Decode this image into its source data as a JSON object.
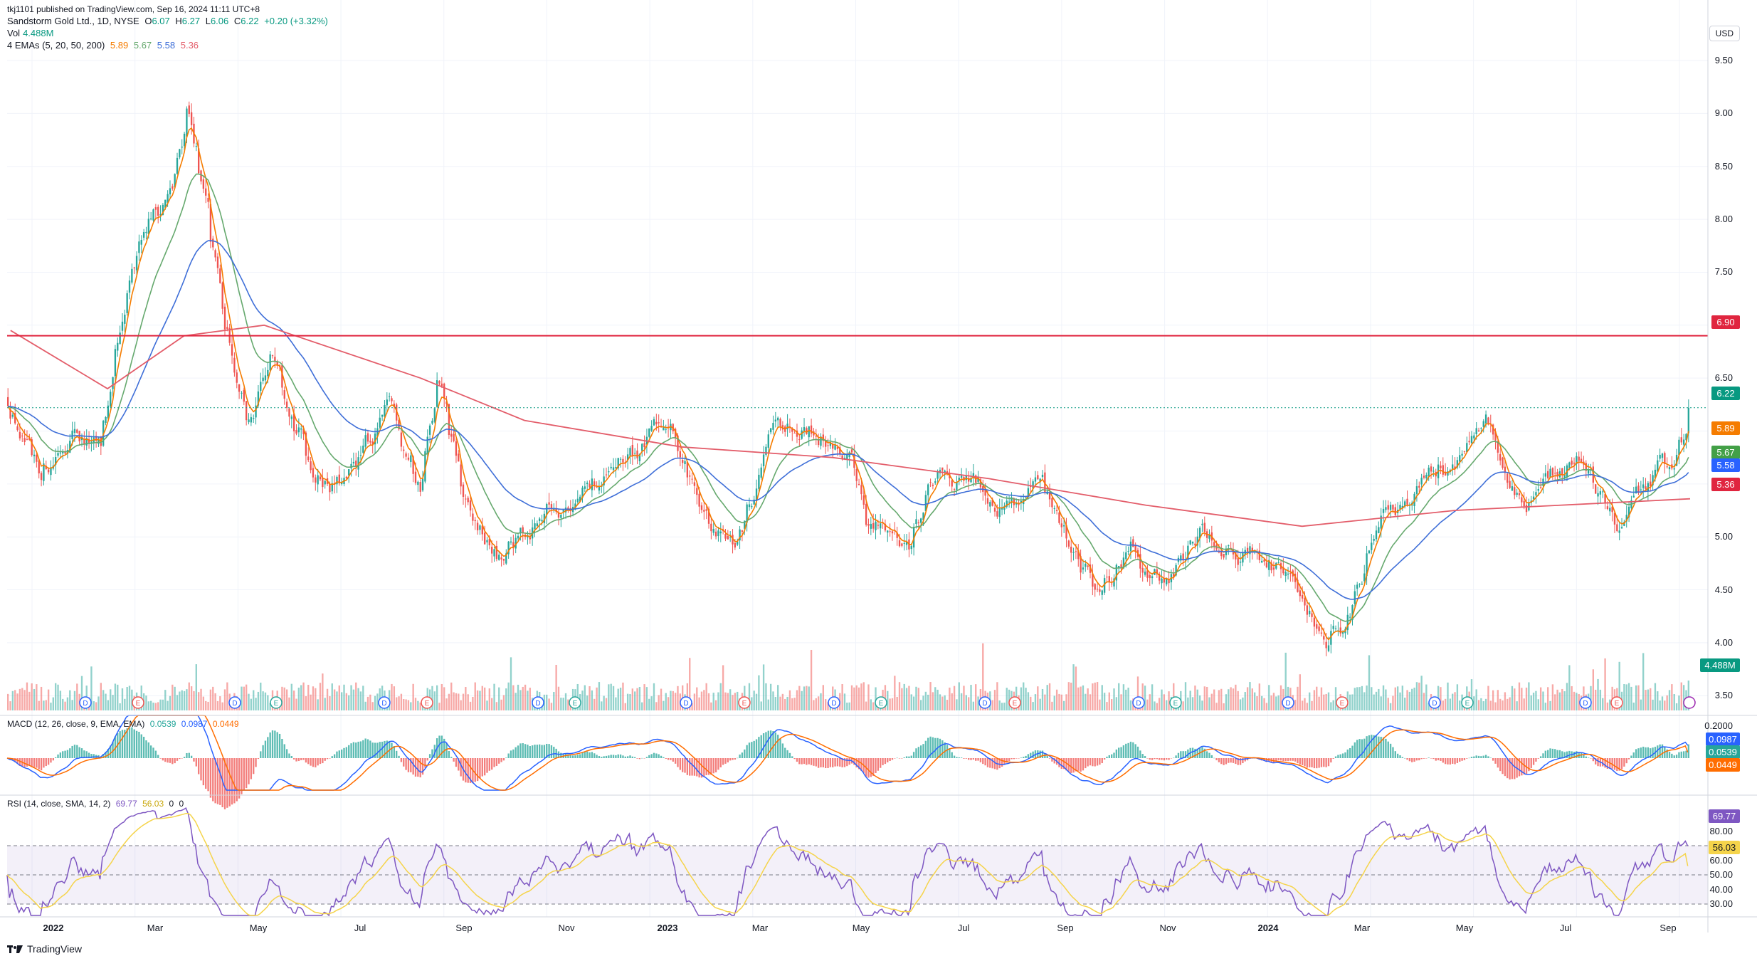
{
  "header": {
    "published": "tkj1101 published on TradingView.com, Sep 16, 2024 11:11 UTC+8",
    "symbol": "Sandstorm Gold Ltd., 1D, NYSE",
    "o_label": "O",
    "o_val": "6.07",
    "h_label": "H",
    "h_val": "6.27",
    "l_label": "L",
    "l_val": "6.06",
    "c_label": "C",
    "c_val": "6.22",
    "change": "+0.20 (+3.32%)",
    "vol_label": "Vol",
    "vol_val": "4.488M",
    "ema_label": "4 EMAs (5, 20, 50, 200)",
    "ema_vals": [
      "5.89",
      "5.67",
      "5.58",
      "5.36"
    ],
    "currency": "USD"
  },
  "colors": {
    "up": "#26a69a",
    "down": "#ef5350",
    "ema5": "#f57c00",
    "ema20": "#66a96e",
    "ema50": "#3f6fd8",
    "ema200": "#e35d6a",
    "hline": "#e0253f",
    "macd": "#2962ff",
    "signal": "#ff6d00",
    "rsi": "#7e57c2",
    "rsi_ma": "#f5d44b"
  },
  "price_axis": [
    "9.50",
    "9.00",
    "8.50",
    "8.00",
    "7.50",
    "7.00",
    "6.50",
    "6.00",
    "5.50",
    "5.00",
    "4.50",
    "4.00",
    "3.50"
  ],
  "price_badges": {
    "hline": "6.90",
    "last": "6.22",
    "ema5": "5.89",
    "ema20": "5.67",
    "ema50": "5.58",
    "ema200": "5.36",
    "volume": "4.488M"
  },
  "macd": {
    "label": "MACD (12, 26, close, 9, EMA, EMA)",
    "vals": [
      "0.0539",
      "0.0987",
      "0.0449"
    ],
    "axis": "0.2000",
    "badges": [
      "0.0987",
      "0.0539",
      "0.0449"
    ]
  },
  "rsi": {
    "label": "RSI (14, close, SMA, 14, 2)",
    "vals": [
      "69.77",
      "56.03",
      "0",
      "0"
    ],
    "axis": [
      "80.00",
      "60.00",
      "50.00",
      "40.00",
      "30.00"
    ],
    "badges": [
      "69.77",
      "56.03"
    ]
  },
  "x_axis": [
    "2022",
    "Mar",
    "May",
    "Jul",
    "Sep",
    "Nov",
    "2023",
    "Mar",
    "May",
    "Jul",
    "Sep",
    "Nov",
    "2024",
    "Mar",
    "May",
    "Jul",
    "Sep"
  ],
  "events": [
    "D",
    "E",
    "D",
    "E",
    "D",
    "E",
    "D",
    "E",
    "D",
    "E",
    "D",
    "E",
    "D",
    "E",
    "D",
    "E",
    "D",
    "E",
    "D",
    "E",
    "D",
    "E",
    "D",
    "E",
    "D"
  ],
  "footer": {
    "brand": "TradingView"
  },
  "chart_data": {
    "type": "candlestick",
    "title": "Sandstorm Gold Ltd., 1D, NYSE",
    "x_range": [
      "2022-01-01",
      "2024-09-16"
    ],
    "ylim": [
      3.3,
      9.7
    ],
    "horizontal_line": 6.9,
    "last_price": 6.22,
    "price_path": [
      {
        "date": "2022-01-03",
        "price": 6.3
      },
      {
        "date": "2022-01-20",
        "price": 5.45
      },
      {
        "date": "2022-02-10",
        "price": 6.1
      },
      {
        "date": "2022-02-25",
        "price": 5.8
      },
      {
        "date": "2022-03-10",
        "price": 6.8
      },
      {
        "date": "2022-03-25",
        "price": 8.0
      },
      {
        "date": "2022-04-10",
        "price": 8.3
      },
      {
        "date": "2022-04-18",
        "price": 9.1
      },
      {
        "date": "2022-04-28",
        "price": 8.1
      },
      {
        "date": "2022-05-10",
        "price": 6.9
      },
      {
        "date": "2022-05-25",
        "price": 6.1
      },
      {
        "date": "2022-06-10",
        "price": 6.7
      },
      {
        "date": "2022-07-01",
        "price": 5.7
      },
      {
        "date": "2022-07-20",
        "price": 5.5
      },
      {
        "date": "2022-08-15",
        "price": 6.2
      },
      {
        "date": "2022-09-01",
        "price": 5.5
      },
      {
        "date": "2022-09-12",
        "price": 6.4
      },
      {
        "date": "2022-09-30",
        "price": 5.1
      },
      {
        "date": "2022-10-20",
        "price": 4.7
      },
      {
        "date": "2022-11-15",
        "price": 5.3
      },
      {
        "date": "2022-12-20",
        "price": 5.5
      },
      {
        "date": "2023-01-25",
        "price": 6.1
      },
      {
        "date": "2023-02-20",
        "price": 5.0
      },
      {
        "date": "2023-03-05",
        "price": 4.8
      },
      {
        "date": "2023-03-25",
        "price": 5.9
      },
      {
        "date": "2023-04-15",
        "price": 6.2
      },
      {
        "date": "2023-05-05",
        "price": 5.9
      },
      {
        "date": "2023-05-25",
        "price": 5.1
      },
      {
        "date": "2023-06-15",
        "price": 5.0
      },
      {
        "date": "2023-07-01",
        "price": 5.5
      },
      {
        "date": "2023-08-01",
        "price": 5.4
      },
      {
        "date": "2023-09-01",
        "price": 5.4
      },
      {
        "date": "2023-10-01",
        "price": 4.5
      },
      {
        "date": "2023-10-25",
        "price": 4.9
      },
      {
        "date": "2023-11-15",
        "price": 4.6
      },
      {
        "date": "2023-12-05",
        "price": 5.1
      },
      {
        "date": "2024-01-10",
        "price": 4.9
      },
      {
        "date": "2024-02-15",
        "price": 4.1
      },
      {
        "date": "2024-03-05",
        "price": 4.5
      },
      {
        "date": "2024-03-25",
        "price": 5.3
      },
      {
        "date": "2024-04-15",
        "price": 5.6
      },
      {
        "date": "2024-05-20",
        "price": 6.0
      },
      {
        "date": "2024-06-10",
        "price": 5.3
      },
      {
        "date": "2024-07-15",
        "price": 5.8
      },
      {
        "date": "2024-08-05",
        "price": 5.0
      },
      {
        "date": "2024-08-30",
        "price": 5.7
      },
      {
        "date": "2024-09-06",
        "price": 5.5
      },
      {
        "date": "2024-09-16",
        "price": 6.22
      }
    ],
    "ema200_path": [
      {
        "date": "2022-01-03",
        "price": 6.95
      },
      {
        "date": "2022-03-01",
        "price": 6.4
      },
      {
        "date": "2022-04-15",
        "price": 6.9
      },
      {
        "date": "2022-06-01",
        "price": 7.0
      },
      {
        "date": "2022-09-01",
        "price": 6.5
      },
      {
        "date": "2022-11-01",
        "price": 6.1
      },
      {
        "date": "2023-02-01",
        "price": 5.85
      },
      {
        "date": "2023-05-01",
        "price": 5.75
      },
      {
        "date": "2023-08-01",
        "price": 5.55
      },
      {
        "date": "2023-11-01",
        "price": 5.3
      },
      {
        "date": "2024-02-01",
        "price": 5.1
      },
      {
        "date": "2024-05-01",
        "price": 5.25
      },
      {
        "date": "2024-09-16",
        "price": 5.36
      }
    ],
    "ema_last": {
      "ema5": 5.89,
      "ema20": 5.67,
      "ema50": 5.58,
      "ema200": 5.36
    },
    "volume_last": "4.488M",
    "macd_last": {
      "hist": 0.0539,
      "macd": 0.0987,
      "signal": 0.0449
    },
    "rsi_last": {
      "rsi": 69.77,
      "ma": 56.03
    },
    "rsi_levels": [
      70,
      50,
      30
    ]
  }
}
